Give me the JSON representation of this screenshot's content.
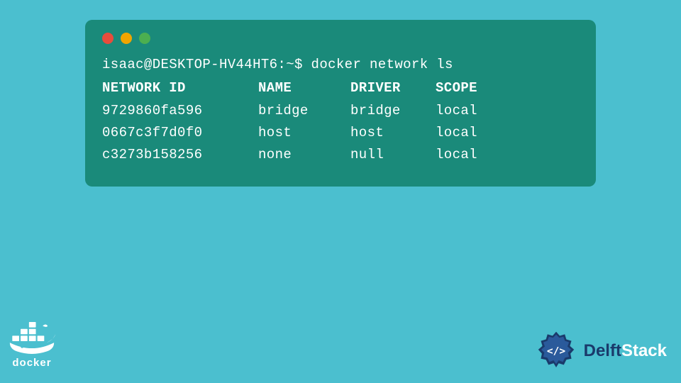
{
  "background": "#4BBFCF",
  "terminal": {
    "bg": "#1A8A7A",
    "command": "isaac@DESKTOP-HV44HT6:~$ docker network ls",
    "headers": {
      "id": "NETWORK ID",
      "name": "NAME",
      "driver": "DRIVER",
      "scope": "SCOPE"
    },
    "rows": [
      {
        "id": "9729860fa596",
        "name": "bridge",
        "driver": "bridge",
        "scope": "local"
      },
      {
        "id": "0667c3f7d0f0",
        "name": "host",
        "driver": "host",
        "scope": "local"
      },
      {
        "id": "c3273b158256",
        "name": "none",
        "driver": "null",
        "scope": "local"
      }
    ]
  },
  "docker_label": "docker",
  "delftstack_label_bold": "Delft",
  "delftstack_label_regular": "Stack",
  "traffic_lights": [
    "red",
    "yellow",
    "green"
  ]
}
